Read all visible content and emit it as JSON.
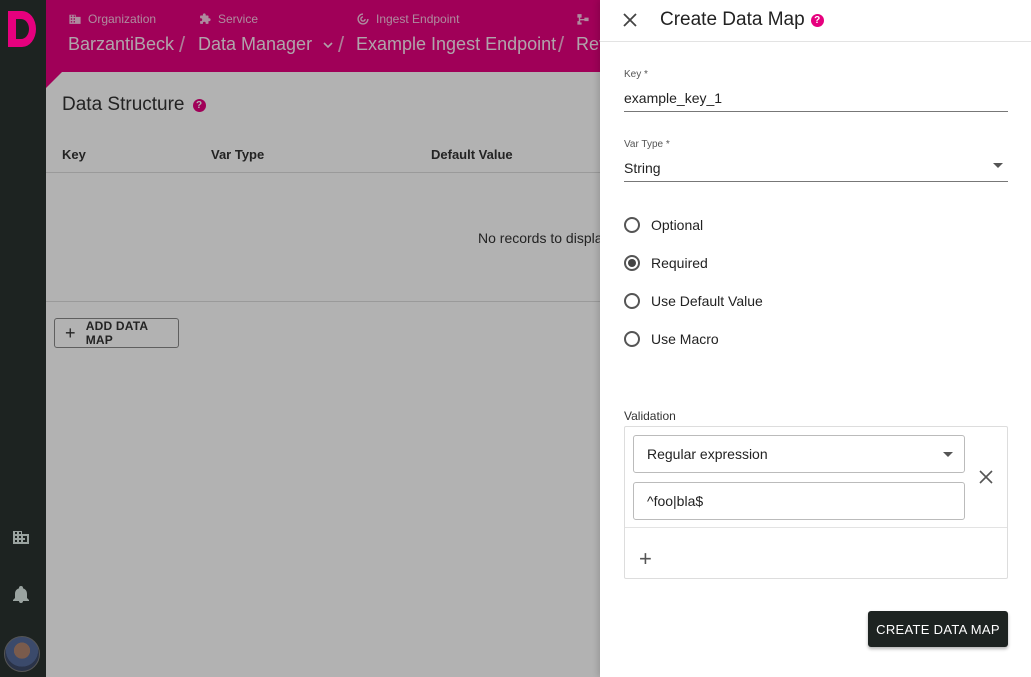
{
  "breadcrumbs": [
    {
      "label": "Organization",
      "value": "BarzantiBeck",
      "icon": "building-icon"
    },
    {
      "label": "Service",
      "value": "Data Manager",
      "icon": "puzzle-icon"
    },
    {
      "label": "Ingest Endpoint",
      "value": "Example Ingest Endpoint",
      "icon": "target-icon"
    },
    {
      "label": "",
      "value": "Rev",
      "icon": "flow-icon"
    }
  ],
  "page": {
    "section_title": "Data Structure",
    "help": "?",
    "columns": [
      "Key",
      "Var Type",
      "Default Value"
    ],
    "empty_text": "No records to display",
    "add_button": "ADD DATA MAP",
    "add_plus": "+"
  },
  "drawer": {
    "title": "Create Data Map",
    "help": "?",
    "key_label": "Key *",
    "key_value": "example_key_1",
    "vartype_label": "Var Type *",
    "vartype_value": "String",
    "radio_options": [
      {
        "label": "Optional",
        "checked": false
      },
      {
        "label": "Required",
        "checked": true
      },
      {
        "label": "Use Default Value",
        "checked": false
      },
      {
        "label": "Use Macro",
        "checked": false
      }
    ],
    "validation_label": "Validation",
    "validation_type": "Regular expression",
    "validation_value": "^foo|bla$",
    "validation_add": "+",
    "submit": "CREATE DATA MAP"
  },
  "colors": {
    "brand": "#e6007e",
    "rail": "#1d2321",
    "button": "#1d2321"
  }
}
